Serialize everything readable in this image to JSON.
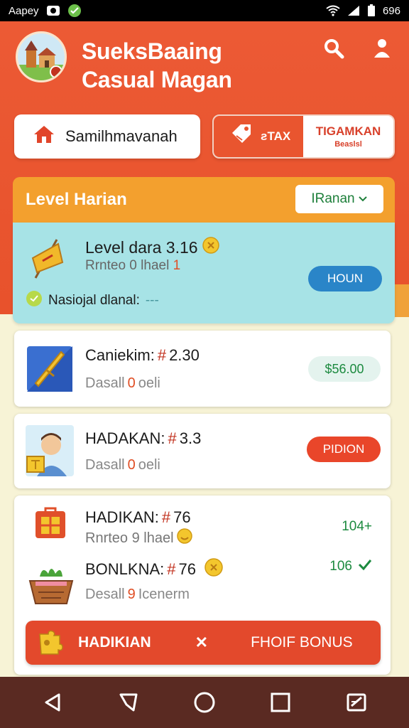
{
  "status_bar": {
    "carrier": "Aapey",
    "time": "696",
    "icons": [
      "camera-app-icon",
      "check-circle-icon",
      "wifi-icon",
      "signal-icon",
      "battery-icon"
    ]
  },
  "header": {
    "title_line1": "SueksBaaing",
    "title_line2": "Casual Magan",
    "search_icon": "search-icon",
    "profile_icon": "profile-icon"
  },
  "pills": {
    "left_label": "Samilhmavanah",
    "right_red_label": "ƨTAX",
    "right_label_line1": "TIGAMKAN",
    "right_label_line2": "Beaslsl"
  },
  "level_card": {
    "title": "Level Harian",
    "select_value": "IRanan"
  },
  "featured": {
    "line1": "Level dara 3.16",
    "line2_text": "Rrnteo 0 lhael",
    "line2_num": "1",
    "line3": "Nasiojal dlanal:",
    "line3_suffix": "---",
    "button": "HOUN"
  },
  "items": [
    {
      "title": "Caniekim: ",
      "hash": "#",
      "value": "2.30",
      "sub_prefix": "Dasall",
      "sub_zero": "0",
      "sub_suffix": "oeli",
      "badge": "$56.00"
    },
    {
      "title": "HADAKAN: ",
      "hash": "#",
      "value": "3.3",
      "sub_prefix": "Dasall",
      "sub_zero": "0",
      "sub_suffix": "oeli",
      "badge": "PIDION"
    }
  ],
  "combined_card": {
    "row1_title": "HADIKAN: ",
    "row1_hash": "#",
    "row1_value": "76",
    "row1_sub": "Rnrteo 9 lhael",
    "row1_right": "104+",
    "row2_title": "BONLKNA: ",
    "row2_hash": "#",
    "row2_value": "76",
    "row2_right": "106",
    "row3_prefix": "Desall",
    "row3_zero": "9",
    "row3_suffix": "Icenerm"
  },
  "cta": {
    "left": "HADIKIAN",
    "x": "✕",
    "right": "FHOIF BONUS"
  },
  "nav": {
    "items": [
      "back-icon",
      "recent-icon",
      "home-icon",
      "overview-icon",
      "edit-icon"
    ]
  },
  "colors": {
    "header_orange": "#e9552f",
    "card_header": "#f3a02e",
    "featured_bg": "#a7e3e6",
    "button_blue": "#2a85c8",
    "badge_green": "#1c8a3f",
    "cta_red": "#e3492c",
    "nav_bg": "#5a2a22"
  }
}
